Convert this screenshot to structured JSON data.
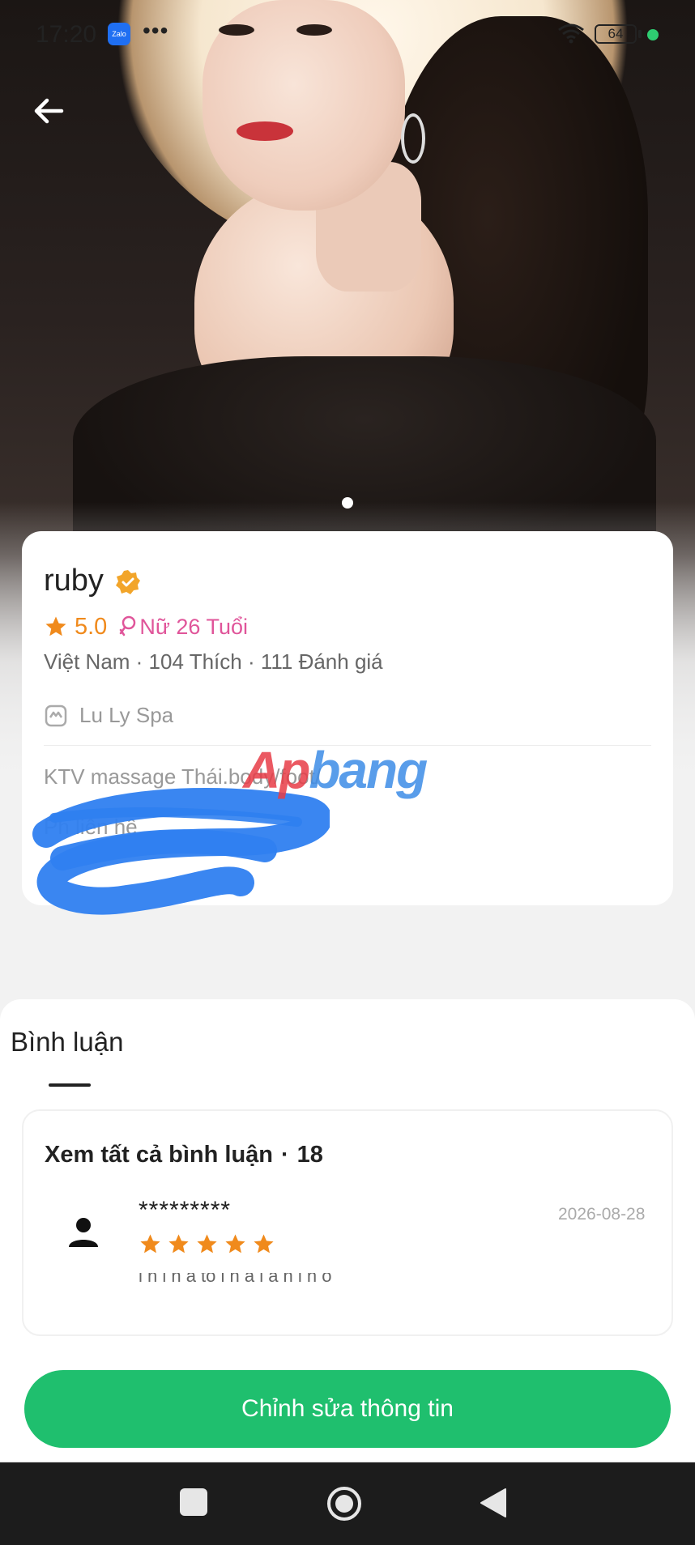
{
  "status_bar": {
    "time": "17:20",
    "app_badge": "Zalo",
    "more": "•••",
    "battery": "64"
  },
  "profile": {
    "name": "ruby",
    "rating": "5.0",
    "gender_age": "Nữ 26 Tuổi",
    "stats": "Việt Nam · 104 Thích · 111 Đánh giá",
    "spa_name": "Lu Ly Spa",
    "service": "KTV massage Thái.body/foot/",
    "contact": "Ph                       liên hệ"
  },
  "watermark": {
    "part1": "Ap",
    "part2": "bang"
  },
  "comments": {
    "title": "Bình luận",
    "see_all_label": "Xem tất cả bình luận",
    "separator": "·",
    "count": "18",
    "review": {
      "name": "*********",
      "date": "2026-08-28",
      "stars": 5,
      "snippet": "l        h    l      h   ả    tố   l    h    ấ               l          á     h    l h  ổ"
    }
  },
  "actions": {
    "edit_label": "Chỉnh sửa thông tin"
  },
  "colors": {
    "accent_green": "#1fbf6e",
    "rating_orange": "#f08a1c",
    "gender_pink": "#e0559a"
  },
  "icons": [
    "back-arrow-icon",
    "verified-badge-icon",
    "star-icon",
    "female-icon",
    "spa-shop-icon",
    "user-avatar-icon",
    "wifi-icon"
  ]
}
